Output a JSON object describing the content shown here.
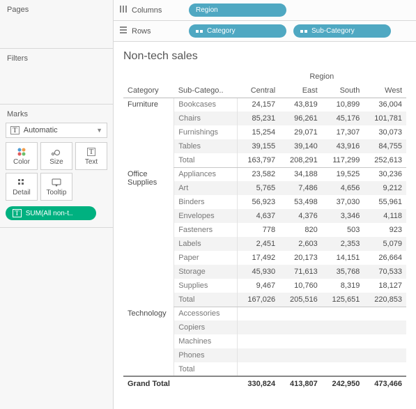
{
  "left": {
    "pages_title": "Pages",
    "filters_title": "Filters",
    "marks_title": "Marks",
    "dropdown_label": "Automatic",
    "cells": {
      "color": "Color",
      "size": "Size",
      "text": "Text",
      "detail": "Detail",
      "tooltip": "Tooltip"
    },
    "measure_pill": "SUM(All non-t.."
  },
  "shelves": {
    "columns_label": "Columns",
    "rows_label": "Rows",
    "columns_pill": "Region",
    "rows_pill1": "Category",
    "rows_pill2": "Sub-Category"
  },
  "viz": {
    "title": "Non-tech sales",
    "region_header": "Region",
    "cat_header": "Category",
    "sub_header": "Sub-Catego..",
    "regions": [
      "Central",
      "East",
      "South",
      "West"
    ],
    "total_label": "Total",
    "grand_total_label": "Grand Total",
    "categories": [
      {
        "name": "Furniture",
        "rows": [
          {
            "sub": "Bookcases",
            "vals": [
              "24,157",
              "43,819",
              "10,899",
              "36,004"
            ]
          },
          {
            "sub": "Chairs",
            "vals": [
              "85,231",
              "96,261",
              "45,176",
              "101,781"
            ]
          },
          {
            "sub": "Furnishings",
            "vals": [
              "15,254",
              "29,071",
              "17,307",
              "30,073"
            ]
          },
          {
            "sub": "Tables",
            "vals": [
              "39,155",
              "39,140",
              "43,916",
              "84,755"
            ]
          }
        ],
        "total": [
          "163,797",
          "208,291",
          "117,299",
          "252,613"
        ]
      },
      {
        "name": "Office Supplies",
        "rows": [
          {
            "sub": "Appliances",
            "vals": [
              "23,582",
              "34,188",
              "19,525",
              "30,236"
            ]
          },
          {
            "sub": "Art",
            "vals": [
              "5,765",
              "7,486",
              "4,656",
              "9,212"
            ]
          },
          {
            "sub": "Binders",
            "vals": [
              "56,923",
              "53,498",
              "37,030",
              "55,961"
            ]
          },
          {
            "sub": "Envelopes",
            "vals": [
              "4,637",
              "4,376",
              "3,346",
              "4,118"
            ]
          },
          {
            "sub": "Fasteners",
            "vals": [
              "778",
              "820",
              "503",
              "923"
            ]
          },
          {
            "sub": "Labels",
            "vals": [
              "2,451",
              "2,603",
              "2,353",
              "5,079"
            ]
          },
          {
            "sub": "Paper",
            "vals": [
              "17,492",
              "20,173",
              "14,151",
              "26,664"
            ]
          },
          {
            "sub": "Storage",
            "vals": [
              "45,930",
              "71,613",
              "35,768",
              "70,533"
            ]
          },
          {
            "sub": "Supplies",
            "vals": [
              "9,467",
              "10,760",
              "8,319",
              "18,127"
            ]
          }
        ],
        "total": [
          "167,026",
          "205,516",
          "125,651",
          "220,853"
        ]
      },
      {
        "name": "Technology",
        "rows": [
          {
            "sub": "Accessories",
            "vals": [
              "",
              "",
              "",
              ""
            ]
          },
          {
            "sub": "Copiers",
            "vals": [
              "",
              "",
              "",
              ""
            ]
          },
          {
            "sub": "Machines",
            "vals": [
              "",
              "",
              "",
              ""
            ]
          },
          {
            "sub": "Phones",
            "vals": [
              "",
              "",
              "",
              ""
            ]
          }
        ],
        "total": [
          "",
          "",
          "",
          ""
        ]
      }
    ],
    "grand_total": [
      "330,824",
      "413,807",
      "242,950",
      "473,466"
    ]
  },
  "chart_data": {
    "type": "table",
    "title": "Non-tech sales",
    "columns_label": "Region",
    "column_headers": [
      "Category",
      "Sub-Category",
      "Central",
      "East",
      "South",
      "West"
    ],
    "rows": [
      [
        "Furniture",
        "Bookcases",
        24157,
        43819,
        10899,
        36004
      ],
      [
        "Furniture",
        "Chairs",
        85231,
        96261,
        45176,
        101781
      ],
      [
        "Furniture",
        "Furnishings",
        15254,
        29071,
        17307,
        30073
      ],
      [
        "Furniture",
        "Tables",
        39155,
        39140,
        43916,
        84755
      ],
      [
        "Furniture",
        "Total",
        163797,
        208291,
        117299,
        252613
      ],
      [
        "Office Supplies",
        "Appliances",
        23582,
        34188,
        19525,
        30236
      ],
      [
        "Office Supplies",
        "Art",
        5765,
        7486,
        4656,
        9212
      ],
      [
        "Office Supplies",
        "Binders",
        56923,
        53498,
        37030,
        55961
      ],
      [
        "Office Supplies",
        "Envelopes",
        4637,
        4376,
        3346,
        4118
      ],
      [
        "Office Supplies",
        "Fasteners",
        778,
        820,
        503,
        923
      ],
      [
        "Office Supplies",
        "Labels",
        2451,
        2603,
        2353,
        5079
      ],
      [
        "Office Supplies",
        "Paper",
        17492,
        20173,
        14151,
        26664
      ],
      [
        "Office Supplies",
        "Storage",
        45930,
        71613,
        35768,
        70533
      ],
      [
        "Office Supplies",
        "Supplies",
        9467,
        10760,
        8319,
        18127
      ],
      [
        "Office Supplies",
        "Total",
        167026,
        205516,
        125651,
        220853
      ],
      [
        "Technology",
        "Accessories",
        null,
        null,
        null,
        null
      ],
      [
        "Technology",
        "Copiers",
        null,
        null,
        null,
        null
      ],
      [
        "Technology",
        "Machines",
        null,
        null,
        null,
        null
      ],
      [
        "Technology",
        "Phones",
        null,
        null,
        null,
        null
      ],
      [
        "Technology",
        "Total",
        null,
        null,
        null,
        null
      ],
      [
        "Grand Total",
        "",
        330824,
        413807,
        242950,
        473466
      ]
    ]
  }
}
